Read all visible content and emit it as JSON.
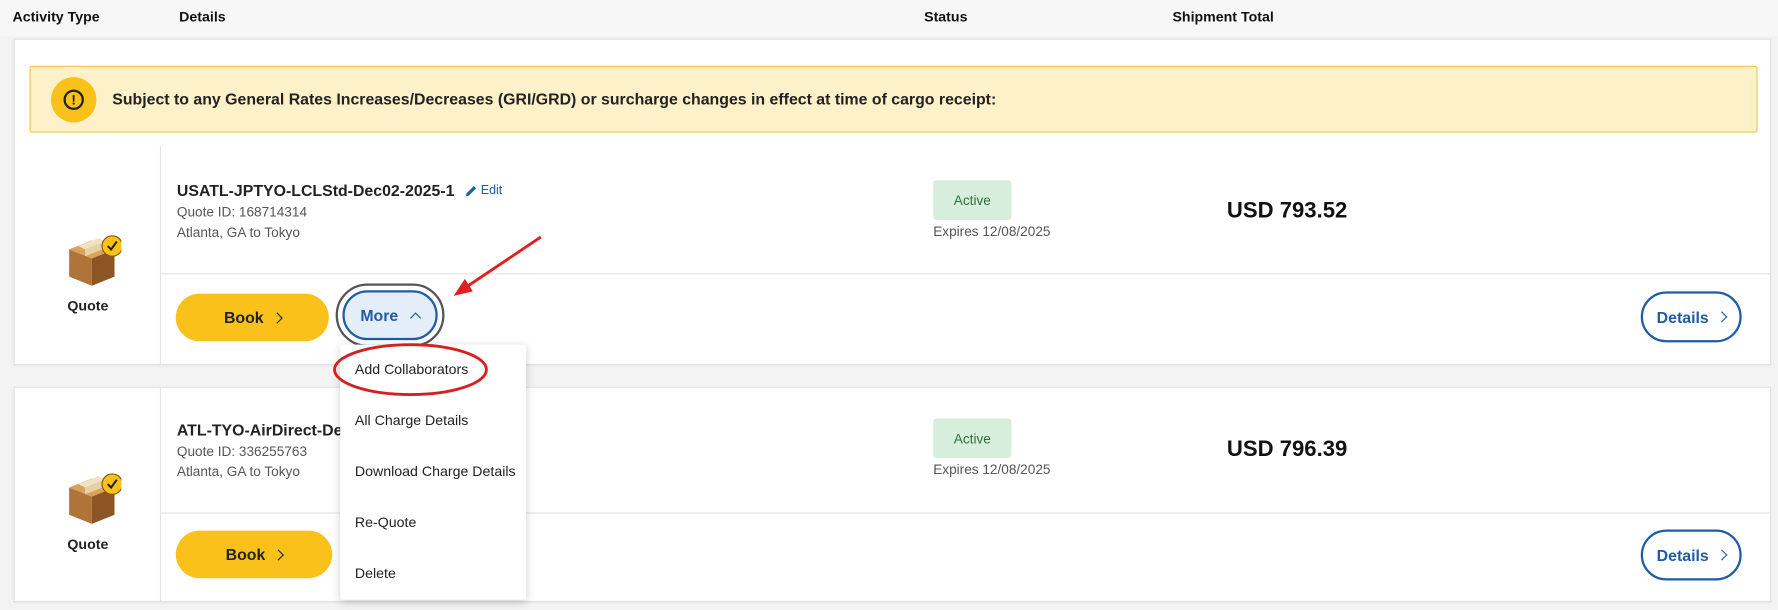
{
  "columns": {
    "activity_type": "Activity Type",
    "details": "Details",
    "status": "Status",
    "shipment_total": "Shipment Total"
  },
  "banner": {
    "icon": "exclamation-icon",
    "text": "Subject to any General Rates Increases/Decreases (GRI/GRD) or surcharge changes in effect at time of cargo receipt:"
  },
  "quotes": [
    {
      "type_label": "Quote",
      "name": "USATL-JPTYO-LCLStd-Dec02-2025-1",
      "edit_label": "Edit",
      "quote_id": "Quote ID: 168714314",
      "route": "Atlanta, GA to Tokyo",
      "status": "Active",
      "expires": "Expires 12/08/2025",
      "total": "USD 793.52",
      "book_label": "Book",
      "more_label": "More",
      "details_label": "Details"
    },
    {
      "type_label": "Quote",
      "name": "ATL-TYO-AirDirect-Dec",
      "quote_id": "Quote ID: 336255763",
      "route": "Atlanta, GA to Tokyo",
      "status": "Active",
      "expires": "Expires 12/08/2025",
      "total": "USD 796.39",
      "book_label": "Book",
      "details_label": "Details"
    }
  ],
  "more_menu": {
    "items": [
      "Add Collaborators",
      "All Charge Details",
      "Download Charge Details",
      "Re-Quote",
      "Delete"
    ]
  },
  "colors": {
    "brand_yellow": "#f9c11a",
    "brand_blue": "#1f5ca8",
    "status_green_bg": "#d7eedc",
    "annotation_red": "#e02020"
  }
}
